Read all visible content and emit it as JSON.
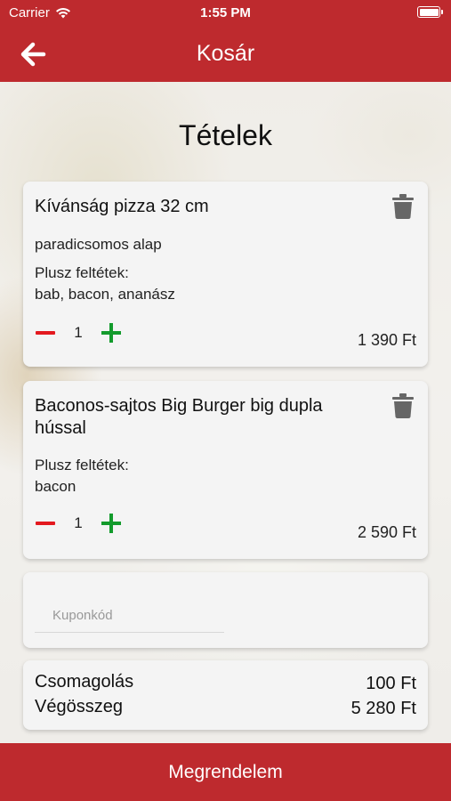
{
  "status_bar": {
    "carrier": "Carrier",
    "time": "1:55 PM"
  },
  "nav": {
    "title": "Kosár"
  },
  "section_title": "Tételek",
  "items": [
    {
      "name": "Kívánság pizza 32 cm",
      "base": "paradicsomos alap",
      "extras_label": "Plusz feltétek:",
      "extras": "bab, bacon, ananász",
      "quantity": "1",
      "price": "1 390 Ft"
    },
    {
      "name": "Baconos-sajtos Big Burger big dupla hússal",
      "extras_label": "Plusz feltétek:",
      "extras": "bacon",
      "quantity": "1",
      "price": "2 590 Ft"
    }
  ],
  "coupon": {
    "placeholder": "Kuponkód",
    "value": ""
  },
  "summary": {
    "packaging_label": "Csomagolás",
    "packaging_value": "100 Ft",
    "total_label": "Végösszeg",
    "total_value": "5 280 Ft"
  },
  "order_button": "Megrendelem",
  "colors": {
    "brand_red": "#be2a2e",
    "minus_red": "#e3191f",
    "plus_green": "#139b2c"
  },
  "icons": [
    "wifi-icon",
    "battery-icon",
    "back-arrow-icon",
    "trash-icon",
    "minus-icon",
    "plus-icon"
  ]
}
